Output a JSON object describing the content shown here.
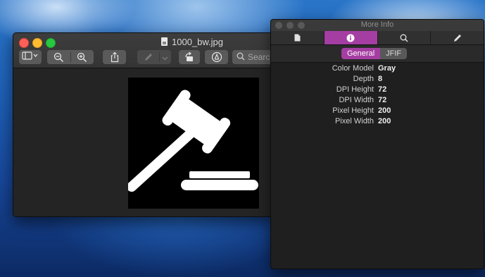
{
  "preview": {
    "window_title": "1000_bw.jpg",
    "search_placeholder": "Search",
    "toolbar": {
      "sidebar_icon": "sidebar-toggle-icon",
      "zoom_out_icon": "zoom-out-icon",
      "zoom_in_icon": "zoom-in-icon",
      "share_icon": "share-icon",
      "markup_icon": "pen-icon",
      "rotate_icon": "rotate-left-icon",
      "annotate_icon": "markup-circle-icon"
    },
    "image": {
      "subject": "gavel-icon",
      "background": "#000000",
      "foreground": "#ffffff"
    }
  },
  "info_panel": {
    "title": "More Info",
    "tabs": [
      {
        "icon": "document-icon",
        "active": false
      },
      {
        "icon": "info-icon",
        "active": true
      },
      {
        "icon": "magnifier-icon",
        "active": false
      },
      {
        "icon": "pencil-icon",
        "active": false
      }
    ],
    "sections": [
      "General",
      "JFIF"
    ],
    "active_section": "General",
    "properties": [
      {
        "key": "Color Model",
        "value": "Gray"
      },
      {
        "key": "Depth",
        "value": "8"
      },
      {
        "key": "DPI Height",
        "value": "72"
      },
      {
        "key": "DPI Width",
        "value": "72"
      },
      {
        "key": "Pixel Height",
        "value": "200"
      },
      {
        "key": "Pixel Width",
        "value": "200"
      }
    ]
  },
  "colors": {
    "accent": "#a53ea3",
    "window_bg": "#242424",
    "close": "#fe5f57",
    "minimize": "#febc2e",
    "maximize": "#28c840"
  }
}
